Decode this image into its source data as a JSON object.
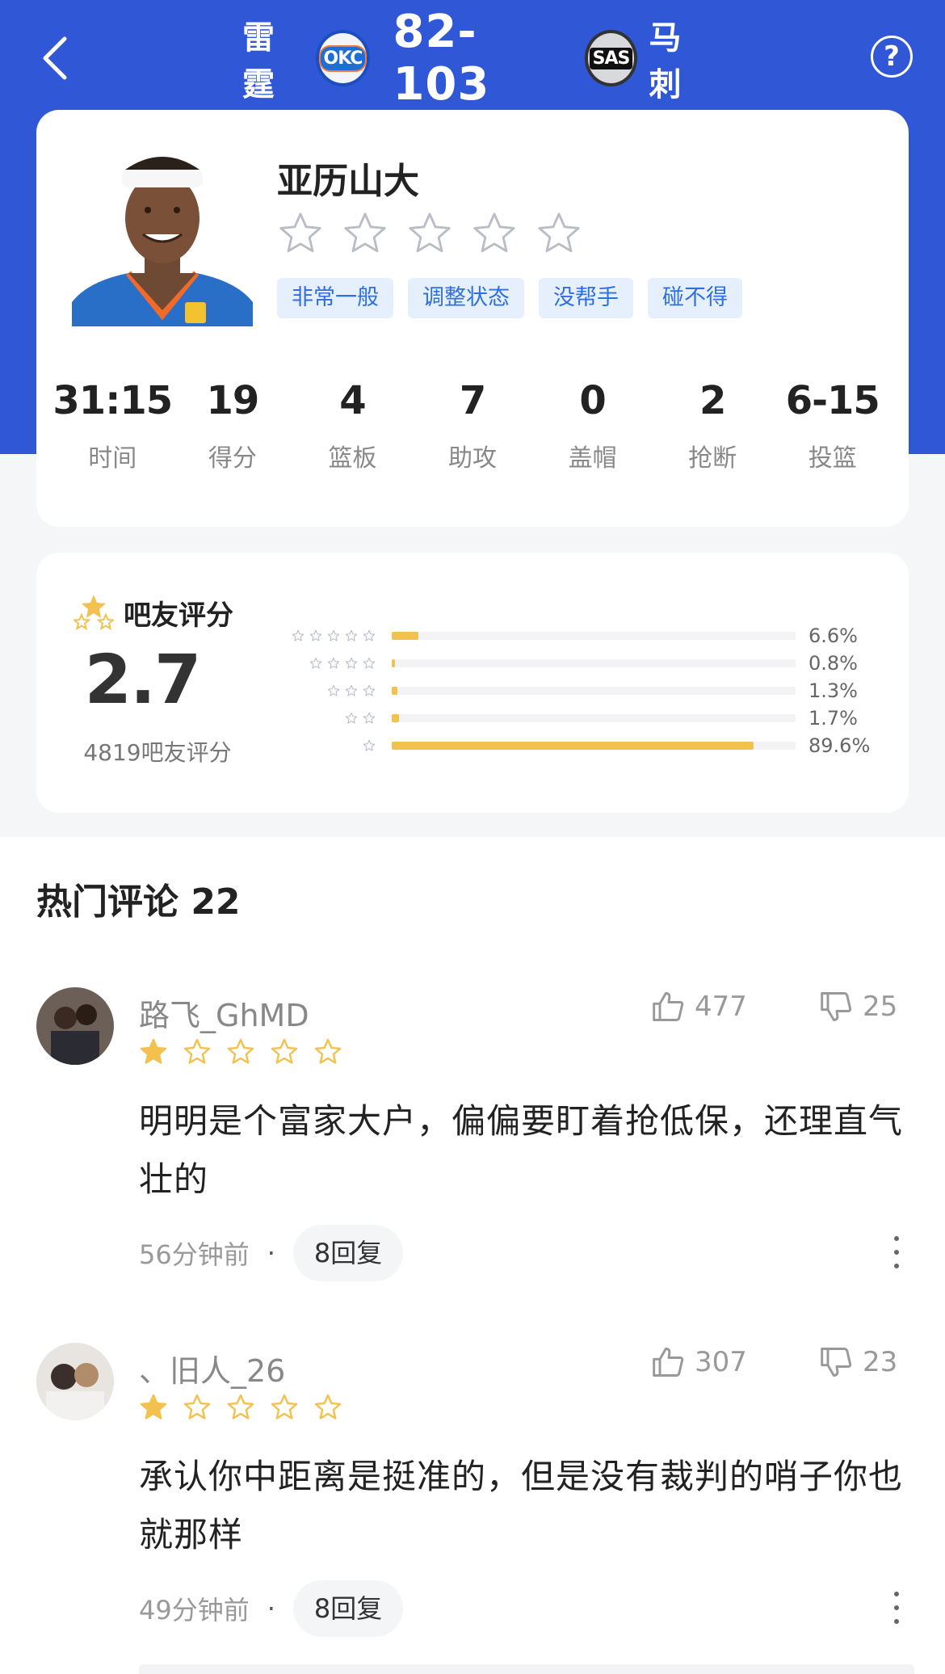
{
  "header": {
    "home_team": "雷霆",
    "home_logo": "OKC",
    "score": "82-103",
    "away_logo": "SAS",
    "away_team": "马刺",
    "help_label": "?",
    "colors": {
      "background": "#2f57d6",
      "text": "#ffffff"
    }
  },
  "player": {
    "name": "亚历山大",
    "star_rating": 0,
    "tags": [
      "非常一般",
      "调整状态",
      "没帮手",
      "碰不得"
    ],
    "stats": [
      {
        "value": "31:15",
        "label": "时间"
      },
      {
        "value": "19",
        "label": "得分"
      },
      {
        "value": "4",
        "label": "篮板"
      },
      {
        "value": "7",
        "label": "助攻"
      },
      {
        "value": "0",
        "label": "盖帽"
      },
      {
        "value": "2",
        "label": "抢断"
      },
      {
        "value": "6-15",
        "label": "投篮"
      }
    ]
  },
  "rating": {
    "title": "吧友评分",
    "score": "2.7",
    "count_label": "4819吧友评分",
    "distribution": [
      {
        "stars": 5,
        "percent": 6.6,
        "label": "6.6%"
      },
      {
        "stars": 4,
        "percent": 0.8,
        "label": "0.8%"
      },
      {
        "stars": 3,
        "percent": 1.3,
        "label": "1.3%"
      },
      {
        "stars": 2,
        "percent": 1.7,
        "label": "1.7%"
      },
      {
        "stars": 1,
        "percent": 89.6,
        "label": "89.6%"
      }
    ],
    "colors": {
      "bar": "#f3c14d",
      "track": "#f3f3f5"
    }
  },
  "comments": {
    "title": "热门评论 22",
    "items": [
      {
        "user": "路飞_GhMD",
        "stars": 1,
        "likes": "477",
        "dislikes": "25",
        "text": "明明是个富家大户，偏偏要盯着抢低保，还理直气壮的",
        "time": "56分钟前",
        "dot": "·",
        "replies": "8回复"
      },
      {
        "user": "、旧人_26",
        "stars": 1,
        "likes": "307",
        "dislikes": "23",
        "text": "承认你中距离是挺准的，但是没有裁判的哨子你也就那样",
        "time": "49分钟前",
        "dot": "·",
        "replies": "8回复"
      }
    ]
  },
  "icons": {
    "back": "chevron-left-icon",
    "help": "help-circle-icon",
    "like": "thumbs-up-icon",
    "dislike": "thumbs-down-icon",
    "more": "more-vertical-icon",
    "star": "star-icon"
  }
}
